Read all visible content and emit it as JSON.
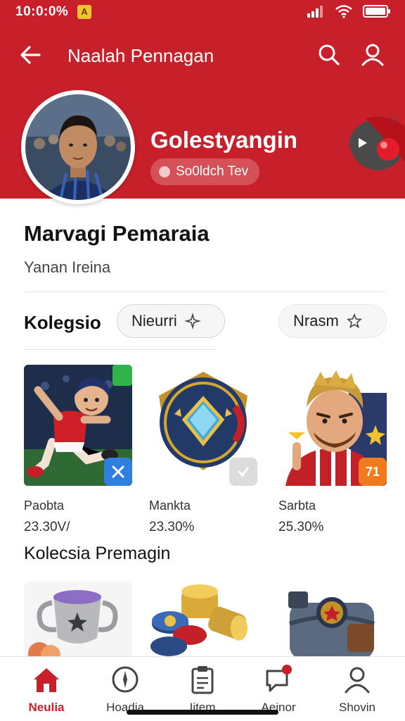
{
  "status": {
    "time": "10:0:0% ",
    "badge": "A"
  },
  "appbar": {
    "title": "Naalah Pennagan"
  },
  "profile": {
    "name": "Golestyangin",
    "chip_label": "So0ldch Tev"
  },
  "section": {
    "title": "Marvagi  Pemaraia",
    "subtitle": "Yanan Ireina"
  },
  "koleksi": {
    "label": "Kolegsio",
    "filter1": "Nieurri",
    "filter2": "Nrasm"
  },
  "cards": [
    {
      "name": "Paobta",
      "value": "23.30V/",
      "badge_text": "",
      "badge_color": "#2f7fe0"
    },
    {
      "name": "Mankta",
      "value": "23.30%",
      "badge_text": "",
      "badge_color": "#dcdcdc"
    },
    {
      "name": "Sarbta",
      "value": "25.30%",
      "badge_text": "71",
      "badge_color": "#f07a1c"
    }
  ],
  "section2": {
    "title": "Kolecsia Premagin"
  },
  "nav": [
    {
      "label": "Neulia",
      "icon": "home-icon",
      "active": true
    },
    {
      "label": "Hoadia",
      "icon": "compass-icon",
      "active": false
    },
    {
      "label": "Iitem",
      "icon": "clipboard-icon",
      "active": false
    },
    {
      "label": "Aeinor",
      "icon": "chat-icon",
      "active": false
    },
    {
      "label": "Shovin",
      "icon": "user-icon",
      "active": false
    }
  ],
  "colors": {
    "brand": "#c8202a",
    "active_nav": "#c8202a"
  }
}
